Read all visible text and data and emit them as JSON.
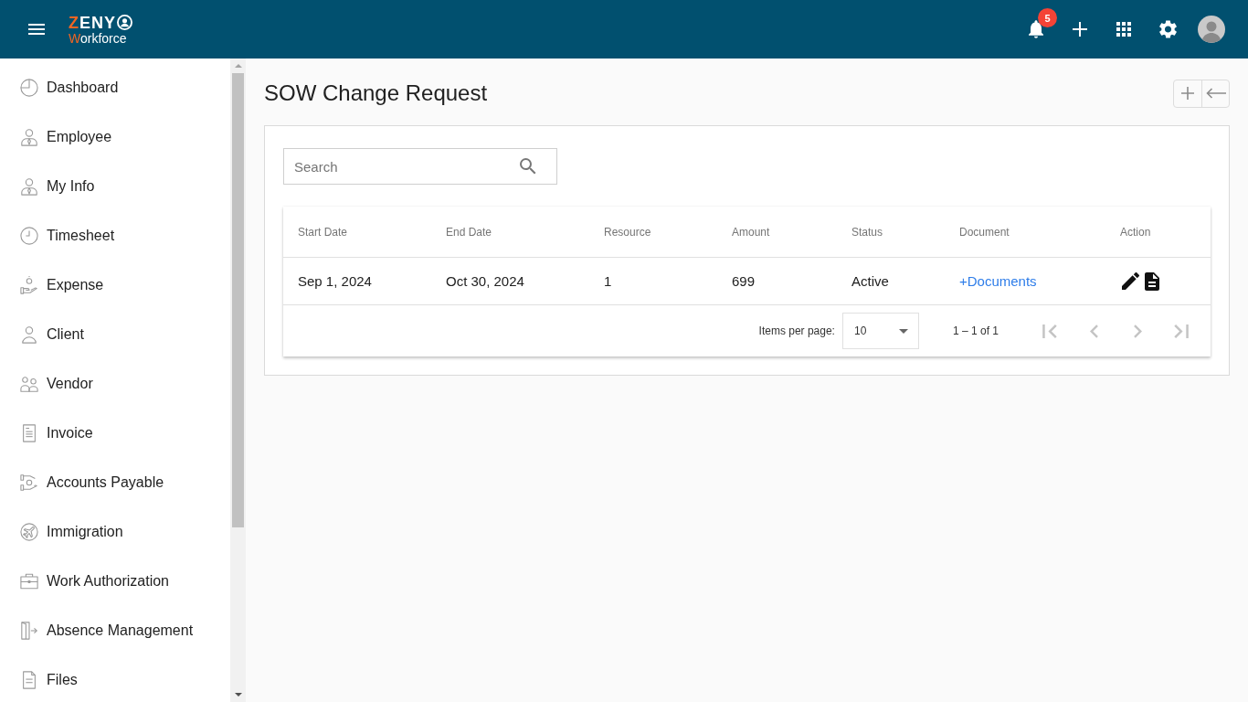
{
  "header": {
    "logo": {
      "title_accent": "Z",
      "title": "ENY",
      "subtitle_accent": "W",
      "subtitle": "orkforce"
    },
    "notifications": {
      "count": "5"
    }
  },
  "sidebar": {
    "items": [
      {
        "label": "Dashboard",
        "kind": "dashboard",
        "selected": false
      },
      {
        "label": "Employee",
        "kind": "employee",
        "selected": false
      },
      {
        "label": "My Info",
        "kind": "employee",
        "selected": false
      },
      {
        "label": "Timesheet",
        "kind": "timesheet",
        "selected": false
      },
      {
        "label": "Expense",
        "kind": "expense",
        "selected": false
      },
      {
        "label": "Client",
        "kind": "client",
        "selected": false
      },
      {
        "label": "Vendor",
        "kind": "vendor",
        "selected": false
      },
      {
        "label": "Invoice",
        "kind": "invoice",
        "selected": false
      },
      {
        "label": "Accounts Payable",
        "kind": "payable",
        "selected": false
      },
      {
        "label": "Immigration",
        "kind": "immigration",
        "selected": false
      },
      {
        "label": "Work Authorization",
        "kind": "workauth",
        "selected": false
      },
      {
        "label": "Absence Management",
        "kind": "absence",
        "selected": false
      },
      {
        "label": "Files",
        "kind": "files",
        "selected": false
      }
    ]
  },
  "page": {
    "title": "SOW Change Request"
  },
  "search": {
    "placeholder": "Search"
  },
  "table": {
    "columns": [
      "Start Date",
      "End Date",
      "Resource",
      "Amount",
      "Status",
      "Document",
      "Action"
    ],
    "rows": [
      {
        "cells": [
          "Sep 1, 2024",
          "Oct 30, 2024",
          "1",
          "699",
          "Active"
        ],
        "document_link": "+Documents"
      }
    ]
  },
  "paginator": {
    "label": "Items per page:",
    "page_size": "10",
    "range": "1 – 1 of 1",
    "nav": [
      {
        "kind": "first",
        "disabled": true
      },
      {
        "kind": "previous",
        "disabled": true
      },
      {
        "kind": "next",
        "disabled": true
      },
      {
        "kind": "last",
        "disabled": true
      }
    ]
  }
}
